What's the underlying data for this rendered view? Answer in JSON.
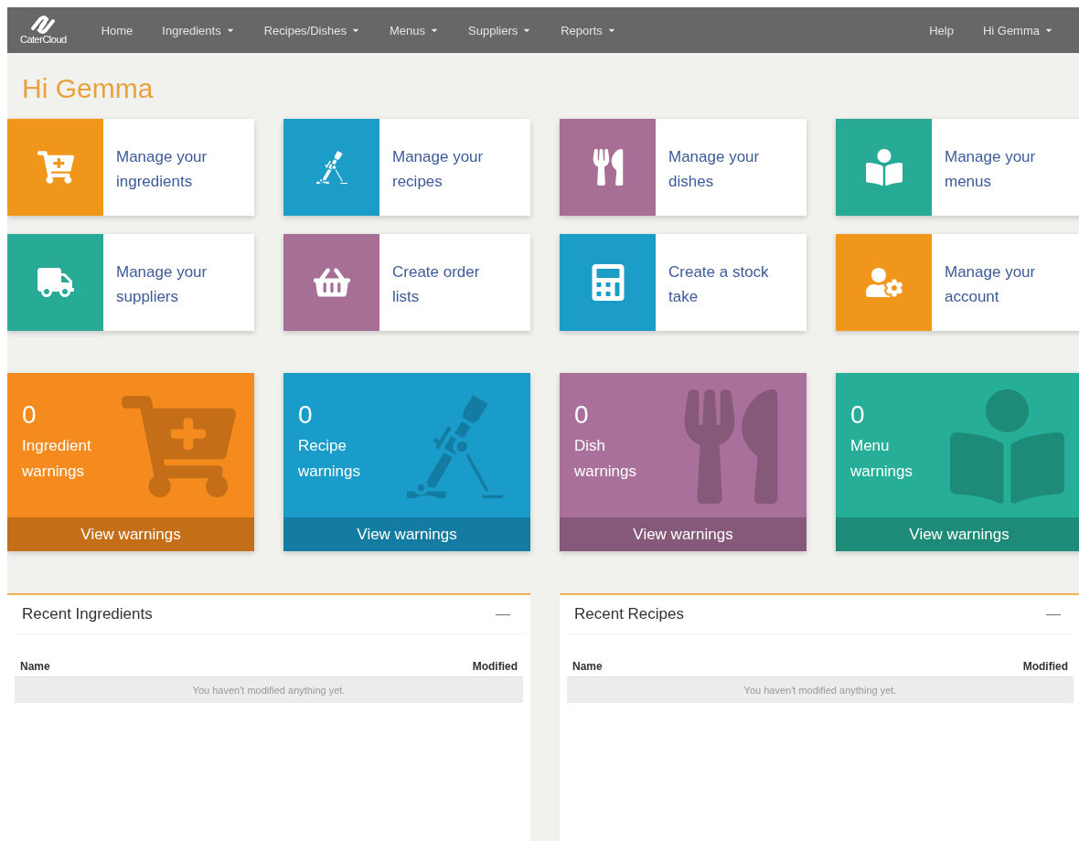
{
  "nav": {
    "logo": "CaterCloud",
    "items": [
      {
        "label": "Home",
        "dropdown": false
      },
      {
        "label": "Ingredients",
        "dropdown": true
      },
      {
        "label": "Recipes/Dishes",
        "dropdown": true
      },
      {
        "label": "Menus",
        "dropdown": true
      },
      {
        "label": "Suppliers",
        "dropdown": true
      },
      {
        "label": "Reports",
        "dropdown": true
      }
    ],
    "right_items": [
      {
        "label": "Help",
        "dropdown": false
      },
      {
        "label": "Hi Gemma",
        "dropdown": true
      }
    ]
  },
  "greeting": "Hi Gemma",
  "action_cards": [
    {
      "label": "Manage your ingredients",
      "color": "#f0961a"
    },
    {
      "label": "Manage your recipes",
      "color": "#1b9dc8"
    },
    {
      "label": "Manage your dishes",
      "color": "#a86f96"
    },
    {
      "label": "Manage your menus",
      "color": "#27ab97"
    },
    {
      "label": "Manage your suppliers",
      "color": "#27ab97"
    },
    {
      "label": "Create order lists",
      "color": "#a86f96"
    },
    {
      "label": "Create a stock take",
      "color": "#1b9dc8"
    },
    {
      "label": "Manage your account",
      "color": "#f0961a"
    }
  ],
  "warning_tiles": [
    {
      "count": "0",
      "label": "Ingredient warnings",
      "link": "View warnings",
      "color": "#f58b1f"
    },
    {
      "count": "0",
      "label": "Recipe warnings",
      "link": "View warnings",
      "color": "#1a9ccb"
    },
    {
      "count": "0",
      "label": "Dish warnings",
      "link": "View warnings",
      "color": "#a8709a"
    },
    {
      "count": "0",
      "label": "Menu warnings",
      "link": "View warnings",
      "color": "#26ae98"
    }
  ],
  "panels": [
    {
      "title": "Recent Ingredients",
      "collapse": "—",
      "columns": [
        "Name",
        "Modified"
      ],
      "empty_message": "You haven't modified anything yet."
    },
    {
      "title": "Recent Recipes",
      "collapse": "—",
      "columns": [
        "Name",
        "Modified"
      ],
      "empty_message": "You haven't modified anything yet."
    }
  ]
}
